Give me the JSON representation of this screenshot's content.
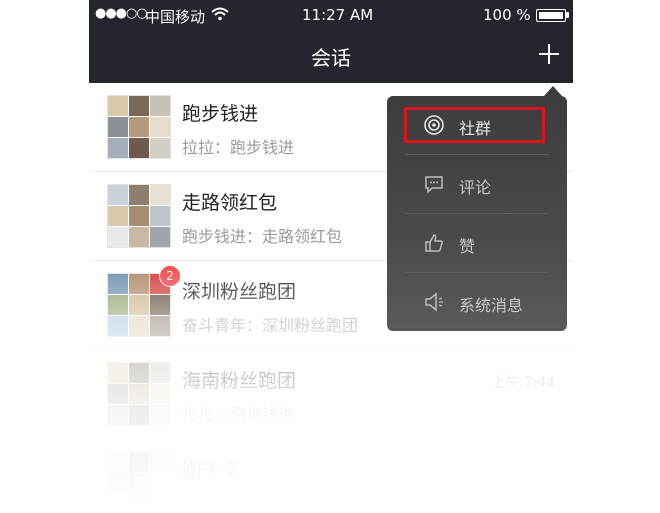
{
  "status_bar": {
    "signal": "●●●○○",
    "carrier": "中国移动",
    "time": "11:27 AM",
    "battery": "100 %"
  },
  "nav": {
    "title": "会话"
  },
  "conversations": [
    {
      "name": "跑步钱进",
      "preview": "拉拉：跑步钱进",
      "time": "",
      "badge": ""
    },
    {
      "name": "走路领红包",
      "preview": "跑步钱进：走路领红包",
      "time": "",
      "badge": ""
    },
    {
      "name": "深圳粉丝跑团",
      "preview": "奋斗青年：深圳粉丝跑团",
      "time": "",
      "badge": "2"
    },
    {
      "name": "海南粉丝跑团",
      "preview": "拉拉：跑步钱进",
      "time": "上午 7:44",
      "badge": ""
    },
    {
      "name": "圈子 2",
      "preview": "",
      "time": "",
      "badge": ""
    }
  ],
  "popup_menu": {
    "items": [
      {
        "label": "社群",
        "icon": "community-icon"
      },
      {
        "label": "评论",
        "icon": "comment-icon"
      },
      {
        "label": "赞",
        "icon": "thumbs-up-icon"
      },
      {
        "label": "系统消息",
        "icon": "speaker-icon"
      }
    ],
    "highlighted": "社群",
    "highlight_color": "#d9141b"
  },
  "colors": {
    "header_bg": "#23252f",
    "badge": "#f04848",
    "menu_bg": "#3c3c3e"
  }
}
